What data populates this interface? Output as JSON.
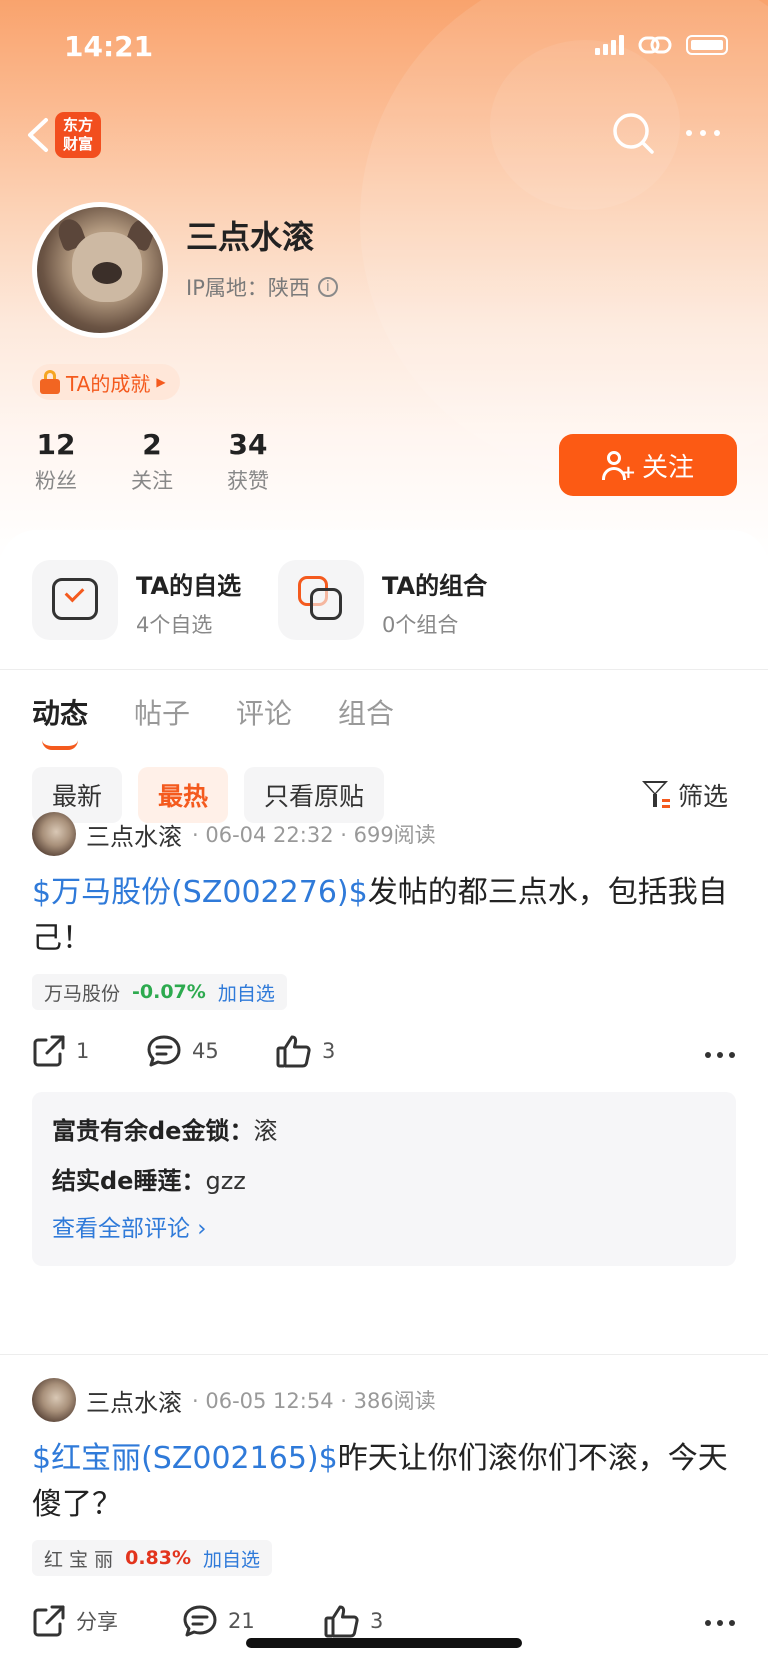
{
  "status_bar": {
    "time": "14:21"
  },
  "header": {
    "logo_line1": "东方",
    "logo_line2": "财富"
  },
  "profile": {
    "name": "三点水滚",
    "ip_label": "IP属地：陕西",
    "achievement": "TA的成就",
    "stats": [
      {
        "num": "12",
        "label": "粉丝"
      },
      {
        "num": "2",
        "label": "关注"
      },
      {
        "num": "34",
        "label": "获赞"
      }
    ],
    "follow_label": "关注"
  },
  "shortcuts": [
    {
      "title": "TA的自选",
      "sub": "4个自选"
    },
    {
      "title": "TA的组合",
      "sub": "0个组合"
    }
  ],
  "tabs": [
    "动态",
    "帖子",
    "评论",
    "组合"
  ],
  "filters": [
    "最新",
    "最热",
    "只看原贴"
  ],
  "filter_button": "筛选",
  "posts": [
    {
      "author": "三点水滚",
      "meta": "· 06-04 22:32 · 699阅读",
      "stock_tag": "$万马股份(SZ002276)$",
      "text": "发帖的都三点水，包括我自己！",
      "quote_name": "万马股份",
      "quote_change": "-0.07%",
      "quote_add": "加自选",
      "share": "1",
      "comments": "45",
      "likes": "3",
      "replies": [
        {
          "who": "富贵有余de金锁：",
          "text": "滚"
        },
        {
          "who": "结实de睡莲：",
          "text": "gzz"
        }
      ],
      "see_all": "查看全部评论 ›"
    },
    {
      "author": "三点水滚",
      "meta": "· 06-05 12:54 · 386阅读",
      "stock_tag": "$红宝丽(SZ002165)$",
      "text": "昨天让你们滚你们不滚，今天傻了？",
      "quote_name": "红 宝 丽",
      "quote_change": "0.83%",
      "quote_add": "加自选",
      "share": "分享",
      "comments": "21",
      "likes": "3"
    }
  ],
  "colors": {
    "accent": "#fc5a14",
    "link": "#2f7ad9",
    "down": "#2daa4f",
    "up": "#e2341d"
  }
}
